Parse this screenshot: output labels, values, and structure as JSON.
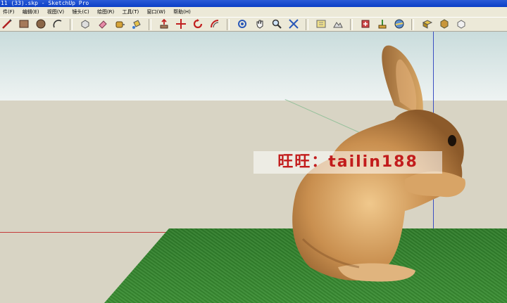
{
  "window": {
    "title": "11 (33).skp - SketchUp Pro"
  },
  "menu": [
    {
      "label": "件(F)"
    },
    {
      "label": "编辑(E)"
    },
    {
      "label": "视图(V)"
    },
    {
      "label": "镜头(C)"
    },
    {
      "label": "绘图(R)"
    },
    {
      "label": "工具(T)"
    },
    {
      "label": "窗口(W)"
    },
    {
      "label": "帮助(H)"
    }
  ],
  "toolbar": {
    "icons": [
      "line-icon",
      "rectangle-icon",
      "circle-icon",
      "arc-icon",
      "make-component-icon",
      "eraser-icon",
      "tape-measure-icon",
      "paint-bucket-icon",
      "push-pull-icon",
      "move-icon",
      "rotate-icon",
      "offset-icon",
      "orbit-icon",
      "pan-icon",
      "zoom-icon",
      "zoom-extents-icon",
      "add-location-icon",
      "toggle-terrain-icon",
      "get-models-icon",
      "share-model-icon",
      "photo-textures-icon",
      "components-icon",
      "extension-warehouse-icon",
      "styles-icon"
    ]
  },
  "watermark": {
    "text": "旺旺：tailin188"
  },
  "colors": {
    "titlebar": "#0b3fc6",
    "menubar": "#ece9d8",
    "watermark": "#c21c1c",
    "grass": "#3a8e33"
  }
}
